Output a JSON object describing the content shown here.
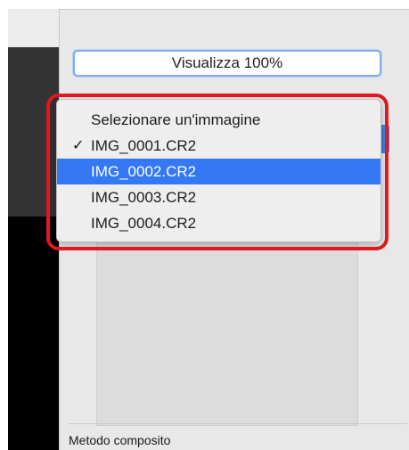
{
  "view_button": {
    "label": "Visualizza 100%"
  },
  "image_menu": {
    "header": "Selezionare un'immagine",
    "items": [
      {
        "label": "IMG_0001.CR2",
        "checked": true,
        "check_glyph": "✓"
      },
      {
        "label": "IMG_0002.CR2",
        "highlighted": true
      },
      {
        "label": "IMG_0003.CR2"
      },
      {
        "label": "IMG_0004.CR2"
      }
    ]
  },
  "bottom_section": {
    "label": "Metodo composito"
  },
  "colors": {
    "selection": "#3478f6",
    "annotation": "#e0191c",
    "focus_ring": "#7eaeee"
  }
}
